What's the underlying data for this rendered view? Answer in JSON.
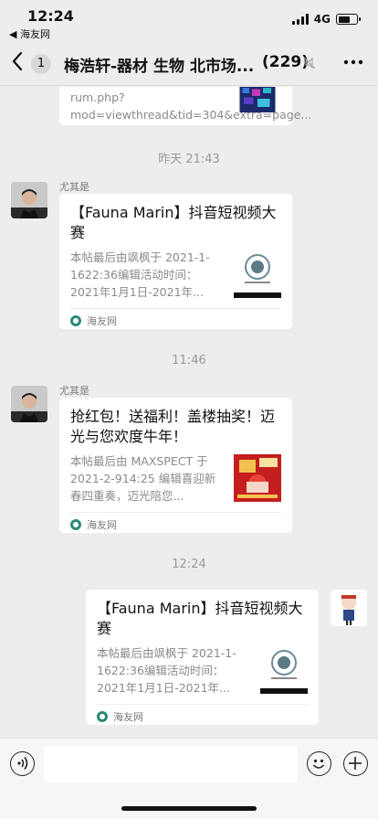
{
  "status_bar": {
    "time": "12:24",
    "back_app": "◀ 海友网",
    "network": "4G"
  },
  "nav": {
    "back_glyph": "<",
    "unread": "1",
    "title": "梅浩轩-器材 生物 北市场...",
    "member_count": "(229)",
    "more_glyph": "•••"
  },
  "messages": [
    {
      "type": "card-partial",
      "text": "rum.php?mod=viewthread&tid=304&extra=page..."
    },
    {
      "type": "timestamp",
      "text": "昨天 21:43"
    },
    {
      "type": "card",
      "side": "left",
      "sender": "尤其是",
      "title": "【Fauna Marin】抖音短视频大赛",
      "desc": "本帖最后由飒枫于 2021-1-1622:36编辑活动时间：2021年1月1日-2021年...",
      "source": "海友网"
    },
    {
      "type": "timestamp",
      "text": "11:46"
    },
    {
      "type": "card",
      "side": "left",
      "sender": "尤其是",
      "title": "抢红包！送福利！盖楼抽奖！迈光与您欢度牛年！",
      "desc": "本帖最后由 MAXSPECT 于 2021-2-914:25 编辑喜迎新春四重奏，迈光陪您...",
      "source": "海友网"
    },
    {
      "type": "timestamp",
      "text": "12:24"
    },
    {
      "type": "card",
      "side": "right",
      "title": "【Fauna Marin】抖音短视频大赛",
      "desc": "本帖最后由飒枫于 2021-1-1622:36编辑活动时间：2021年1月1日-2021年...",
      "source": "海友网"
    }
  ],
  "colors": {
    "background": "#ededed",
    "card": "#ffffff",
    "source_icon": "#2a8b78",
    "muted_text": "#8a8a8a"
  }
}
